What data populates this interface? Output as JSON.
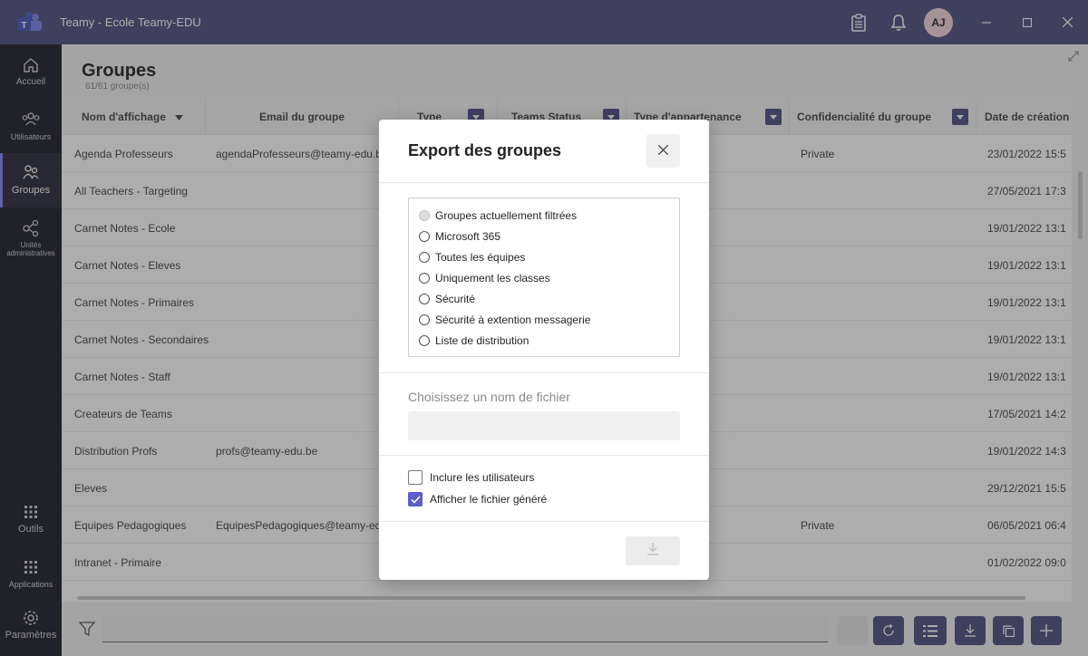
{
  "window": {
    "title": "Teamy - Ecole Teamy-EDU",
    "avatar_initials": "AJ"
  },
  "sidebar": {
    "items": [
      {
        "label": "Accueil",
        "icon": "home-icon"
      },
      {
        "label": "Utilisateurs",
        "icon": "users-icon"
      },
      {
        "label": "Groupes",
        "icon": "groups-icon",
        "active": true
      },
      {
        "label": "Unités administratives",
        "icon": "admin-units-icon"
      },
      {
        "label": "Outils",
        "icon": "grid-icon"
      },
      {
        "label": "Applications",
        "icon": "grid-icon"
      },
      {
        "label": "Paramètres",
        "icon": "gear-icon"
      }
    ]
  },
  "page": {
    "title": "Groupes",
    "subtitle": "61/61 groupe(s)"
  },
  "table": {
    "columns": [
      "Nom d'affichage",
      "Email du groupe",
      "Type",
      "Teams Status",
      "Type d'appartenance",
      "Confidencialité du groupe",
      "Date de création"
    ],
    "rows": [
      {
        "name": "Agenda Professeurs",
        "email": "agendaProfesseurs@teamy-edu.be",
        "conf": "Private",
        "date": "23/01/2022 15:5"
      },
      {
        "name": "All Teachers - Targeting",
        "email": "",
        "conf": "",
        "date": "27/05/2021 17:3"
      },
      {
        "name": "Carnet Notes - Ecole",
        "email": "",
        "conf": "",
        "date": "19/01/2022 13:1"
      },
      {
        "name": "Carnet Notes - Eleves",
        "email": "",
        "conf": "",
        "date": "19/01/2022 13:1"
      },
      {
        "name": "Carnet Notes - Primaires",
        "email": "",
        "conf": "",
        "date": "19/01/2022 13:1"
      },
      {
        "name": "Carnet Notes - Secondaires",
        "email": "",
        "conf": "",
        "date": "19/01/2022 13:1"
      },
      {
        "name": "Carnet Notes - Staff",
        "email": "",
        "conf": "",
        "date": "19/01/2022 13:1"
      },
      {
        "name": "Createurs de Teams",
        "email": "",
        "conf": "",
        "date": "17/05/2021 14:2"
      },
      {
        "name": "Distribution Profs",
        "email": "profs@teamy-edu.be",
        "conf": "",
        "date": "19/01/2022 14:3"
      },
      {
        "name": "Eleves",
        "email": "",
        "conf": "",
        "date": "29/12/2021 15:5"
      },
      {
        "name": "Equipes Pedagogiques",
        "email": "EquipesPedagogiques@teamy-edu.be",
        "conf": "Private",
        "date": "06/05/2021 06:4"
      },
      {
        "name": "Intranet - Primaire",
        "email": "",
        "conf": "",
        "date": "01/02/2022 09:0"
      }
    ]
  },
  "dialog": {
    "title": "Export des groupes",
    "options": [
      "Groupes actuellement filtrées",
      "Microsoft 365",
      "Toutes les équipes",
      "Uniquement les classes",
      "Sécurité",
      "Sécurité à extention messagerie",
      "Liste de distribution"
    ],
    "filename_label": "Choisissez un nom de fichier",
    "filename_value": "",
    "include_users_label": "Inclure les utilisateurs",
    "show_file_label": "Afficher le fichier généré"
  },
  "colors": {
    "accent": "#4e4e80",
    "sidebar": "#1e1e2a",
    "checkbox": "#5b5fc7"
  }
}
